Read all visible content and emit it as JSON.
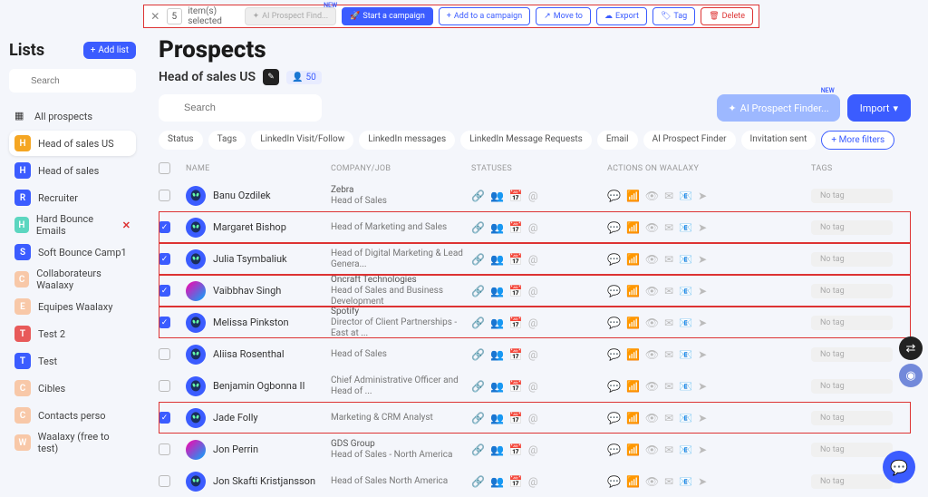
{
  "selection_bar": {
    "count": "5",
    "items_selected": "item(s) selected",
    "ai_prospect": "AI Prospect Find...",
    "new_badge": "NEW",
    "start_campaign": "Start a campaign",
    "add_campaign": "Add to a campaign",
    "move_to": "Move to",
    "export": "Export",
    "tag": "Tag",
    "delete": "Delete"
  },
  "sidebar": {
    "title": "Lists",
    "add_list": "Add list",
    "search_placeholder": "Search",
    "all_prospects": "All prospects",
    "items": [
      {
        "letter": "H",
        "color": "#f5a623",
        "label": "Head of sales US",
        "active": true
      },
      {
        "letter": "H",
        "color": "#3b5cff",
        "label": "Head of sales"
      },
      {
        "letter": "R",
        "color": "#3b5cff",
        "label": "Recruiter"
      },
      {
        "letter": "H",
        "color": "#5cd6c0",
        "label": "Hard Bounce Emails",
        "suffix_icon": "✕",
        "suffix_color": "#d33"
      },
      {
        "letter": "S",
        "color": "#3b5cff",
        "label": "Soft Bounce Camp1"
      },
      {
        "letter": "C",
        "color": "#f8c8a8",
        "label": "Collaborateurs Waalaxy"
      },
      {
        "letter": "E",
        "color": "#f8c8a8",
        "label": "Equipes Waalaxy"
      },
      {
        "letter": "T",
        "color": "#e85a5a",
        "label": "Test 2"
      },
      {
        "letter": "T",
        "color": "#3b5cff",
        "label": "Test"
      },
      {
        "letter": "C",
        "color": "#f8c8a8",
        "label": "Cibles"
      },
      {
        "letter": "C",
        "color": "#f8c8a8",
        "label": "Contacts perso"
      },
      {
        "letter": "W",
        "color": "#f8c8a8",
        "label": "Waalaxy (free to test)"
      }
    ]
  },
  "main": {
    "title": "Prospects",
    "subtitle": "Head of sales US",
    "count": "50",
    "search_placeholder": "Search",
    "ai_finder": "AI Prospect Finder...",
    "new_badge": "NEW",
    "import": "Import",
    "filters": [
      "Status",
      "Tags",
      "LinkedIn Visit/Follow",
      "LinkedIn messages",
      "LinkedIn Message Requests",
      "Email",
      "AI Prospect Finder",
      "Invitation sent"
    ],
    "more_filters": "More filters",
    "col_name": "NAME",
    "col_company": "COMPANY/JOB",
    "col_statuses": "STATUSES",
    "col_actions": "ACTIONS ON WAALAXY",
    "col_tags": "TAGS",
    "no_tag": "No tag",
    "rows": [
      {
        "checked": false,
        "name": "Banu Ozdilek",
        "company": "Zebra",
        "job": "Head of Sales",
        "hl": false,
        "photo": false
      },
      {
        "checked": true,
        "name": "Margaret Bishop",
        "company": "",
        "job": "Head of Marketing and Sales",
        "hl": true,
        "photo": false
      },
      {
        "checked": true,
        "name": "Julia Tsymbaliuk",
        "company": "",
        "job": "Head of Digital Marketing & Lead Genera...",
        "hl": true,
        "photo": false
      },
      {
        "checked": true,
        "name": "Vaibbhav Singh",
        "company": "Oncraft Technologies",
        "job": "Head of Sales and Business Development",
        "hl": true,
        "photo": true
      },
      {
        "checked": true,
        "name": "Melissa Pinkston",
        "company": "Spotify",
        "job": "Director of Client Partnerships - East at ...",
        "hl": true,
        "photo": false
      },
      {
        "checked": false,
        "name": "Aliisa Rosenthal",
        "company": "",
        "job": "Head of Sales",
        "hl": false,
        "photo": false
      },
      {
        "checked": false,
        "name": "Benjamin Ogbonna II",
        "company": "",
        "job": "Chief Administrative Officer and Head of ...",
        "hl": false,
        "photo": false
      },
      {
        "checked": true,
        "name": "Jade Folly",
        "company": "",
        "job": "Marketing & CRM Analyst",
        "hl": true,
        "photo": false
      },
      {
        "checked": false,
        "name": "Jon Perrin",
        "company": "GDS Group",
        "job": "Head of Sales - North America",
        "hl": false,
        "photo": true
      },
      {
        "checked": false,
        "name": "Jon Skafti Kristjansson",
        "company": "",
        "job": "Head of Sales North America",
        "hl": false,
        "photo": false
      }
    ]
  }
}
